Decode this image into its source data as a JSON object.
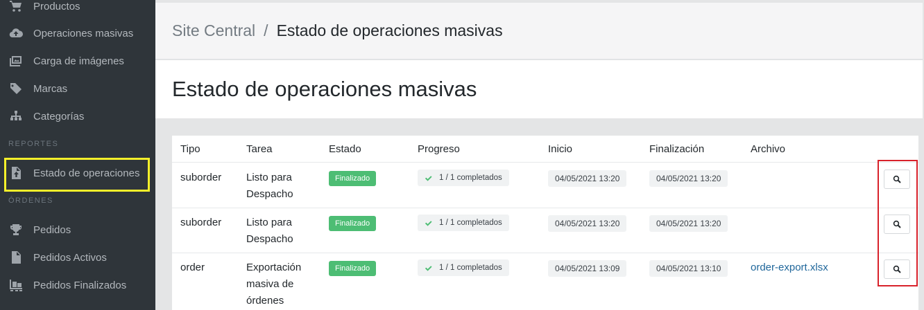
{
  "sidebar": {
    "items": [
      {
        "label": "Productos",
        "icon": "cart-icon"
      },
      {
        "label": "Operaciones masivas",
        "icon": "cloud-upload-icon"
      },
      {
        "label": "Carga de imágenes",
        "icon": "images-icon"
      },
      {
        "label": "Marcas",
        "icon": "tags-icon"
      },
      {
        "label": "Categorías",
        "icon": "sitemap-icon"
      }
    ],
    "section_reportes": "REPORTES",
    "reportes_items": [
      {
        "label": "Estado de operaciones",
        "icon": "file-upload-icon"
      }
    ],
    "section_ordenes": "ÓRDENES",
    "ordenes_items": [
      {
        "label": "Pedidos",
        "icon": "trophy-icon"
      },
      {
        "label": "Pedidos Activos",
        "icon": "document-icon"
      },
      {
        "label": "Pedidos Finalizados",
        "icon": "pallet-icon"
      }
    ]
  },
  "breadcrumb": {
    "root": "Site Central",
    "separator": "/",
    "current": "Estado de operaciones masivas"
  },
  "page": {
    "title": "Estado de operaciones masivas"
  },
  "table": {
    "headers": [
      "Tipo",
      "Tarea",
      "Estado",
      "Progreso",
      "Inicio",
      "Finalización",
      "Archivo"
    ],
    "rows": [
      {
        "tipo": "suborder",
        "tarea_l1": "Listo para",
        "tarea_l2": "Despacho",
        "tarea_l3": "",
        "estado": "Finalizado",
        "progreso": "1 / 1 completados",
        "inicio": "04/05/2021 13:20",
        "fin": "04/05/2021 13:20",
        "archivo": ""
      },
      {
        "tipo": "suborder",
        "tarea_l1": "Listo para",
        "tarea_l2": "Despacho",
        "tarea_l3": "",
        "estado": "Finalizado",
        "progreso": "1 / 1 completados",
        "inicio": "04/05/2021 13:20",
        "fin": "04/05/2021 13:20",
        "archivo": ""
      },
      {
        "tipo": "order",
        "tarea_l1": "Exportación",
        "tarea_l2": "masiva de",
        "tarea_l3": "órdenes",
        "estado": "Finalizado",
        "progreso": "1 / 1 completados",
        "inicio": "04/05/2021 13:09",
        "fin": "04/05/2021 13:10",
        "archivo": "order-export.xlsx"
      }
    ]
  },
  "colors": {
    "sidebar_bg": "#2f353a",
    "badge_success": "#4dbd74",
    "link": "#20679b",
    "highlight_yellow": "#f6f02a",
    "highlight_red": "#d8212a"
  }
}
